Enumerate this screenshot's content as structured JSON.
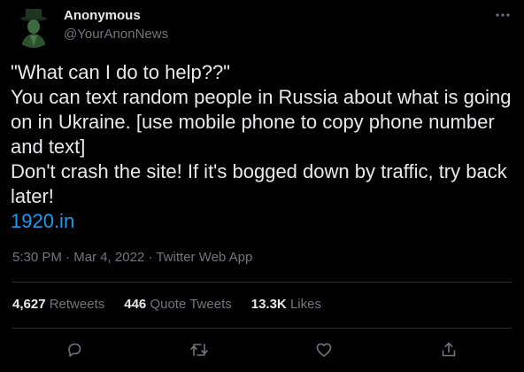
{
  "author": {
    "name": "Anonymous",
    "handle": "@YourAnonNews"
  },
  "tweet": {
    "lines": [
      "\"What can I do to help??\"",
      "You can text random people in Russia about what is going on in Ukraine. [use mobile phone to copy phone number and text]",
      "Don't crash the site! If it's bogged down by traffic, try back later!"
    ],
    "link": "1920.in"
  },
  "meta": {
    "time": "5:30 PM",
    "date": "Mar 4, 2022",
    "source": "Twitter Web App"
  },
  "stats": {
    "retweets_count": "4,627",
    "retweets_label": "Retweets",
    "quote_count": "446",
    "quote_label": "Quote Tweets",
    "likes_count": "13.3K",
    "likes_label": "Likes"
  },
  "icons": {
    "more": "more-horizontal-icon",
    "reply": "reply-icon",
    "retweet": "retweet-icon",
    "like": "heart-icon",
    "share": "share-icon"
  },
  "colors": {
    "background": "#000000",
    "text": "#e7e9ea",
    "muted": "#71767b",
    "link": "#1d9bf0",
    "divider": "#2f3336"
  }
}
